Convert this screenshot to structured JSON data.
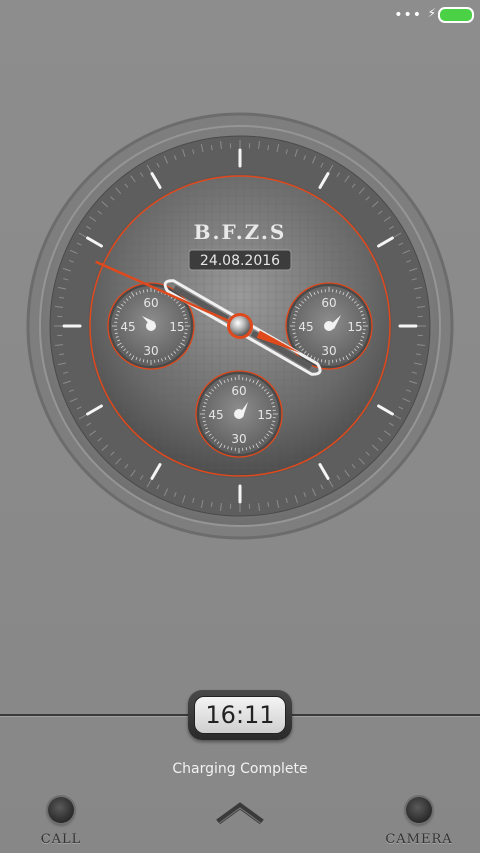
{
  "status_bar": {
    "signal_glyph": "•••",
    "charging_glyph": "⚡",
    "battery_color": "#4bd146"
  },
  "watch": {
    "brand": "B.F.Z.S",
    "date": "24.08.2016",
    "accent_color": "#e0491c",
    "hour_angle_deg": 300,
    "minute_angle_deg": 120,
    "second_angle_deg": 294,
    "subdials": [
      {
        "name": "left",
        "top": "60",
        "right": "15",
        "bottom": "30",
        "left": "45"
      },
      {
        "name": "right",
        "top": "60",
        "right": "15",
        "bottom": "30",
        "left": "45"
      },
      {
        "name": "bottom",
        "top": "60",
        "right": "15",
        "bottom": "30",
        "left": "45"
      }
    ]
  },
  "lockscreen": {
    "time": "16:11",
    "charging_status": "Charging Complete",
    "call_label": "CALL",
    "camera_label": "CAMERA"
  }
}
